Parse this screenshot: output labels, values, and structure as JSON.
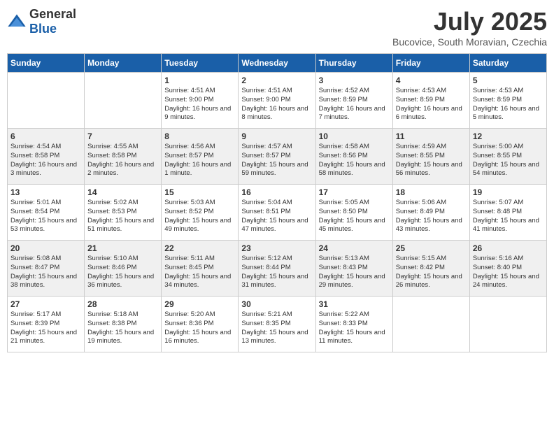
{
  "logo": {
    "general": "General",
    "blue": "Blue"
  },
  "title": "July 2025",
  "subtitle": "Bucovice, South Moravian, Czechia",
  "headers": [
    "Sunday",
    "Monday",
    "Tuesday",
    "Wednesday",
    "Thursday",
    "Friday",
    "Saturday"
  ],
  "weeks": [
    [
      {
        "day": "",
        "info": ""
      },
      {
        "day": "",
        "info": ""
      },
      {
        "day": "1",
        "info": "Sunrise: 4:51 AM\nSunset: 9:00 PM\nDaylight: 16 hours and 9 minutes."
      },
      {
        "day": "2",
        "info": "Sunrise: 4:51 AM\nSunset: 9:00 PM\nDaylight: 16 hours and 8 minutes."
      },
      {
        "day": "3",
        "info": "Sunrise: 4:52 AM\nSunset: 8:59 PM\nDaylight: 16 hours and 7 minutes."
      },
      {
        "day": "4",
        "info": "Sunrise: 4:53 AM\nSunset: 8:59 PM\nDaylight: 16 hours and 6 minutes."
      },
      {
        "day": "5",
        "info": "Sunrise: 4:53 AM\nSunset: 8:59 PM\nDaylight: 16 hours and 5 minutes."
      }
    ],
    [
      {
        "day": "6",
        "info": "Sunrise: 4:54 AM\nSunset: 8:58 PM\nDaylight: 16 hours and 3 minutes."
      },
      {
        "day": "7",
        "info": "Sunrise: 4:55 AM\nSunset: 8:58 PM\nDaylight: 16 hours and 2 minutes."
      },
      {
        "day": "8",
        "info": "Sunrise: 4:56 AM\nSunset: 8:57 PM\nDaylight: 16 hours and 1 minute."
      },
      {
        "day": "9",
        "info": "Sunrise: 4:57 AM\nSunset: 8:57 PM\nDaylight: 15 hours and 59 minutes."
      },
      {
        "day": "10",
        "info": "Sunrise: 4:58 AM\nSunset: 8:56 PM\nDaylight: 15 hours and 58 minutes."
      },
      {
        "day": "11",
        "info": "Sunrise: 4:59 AM\nSunset: 8:55 PM\nDaylight: 15 hours and 56 minutes."
      },
      {
        "day": "12",
        "info": "Sunrise: 5:00 AM\nSunset: 8:55 PM\nDaylight: 15 hours and 54 minutes."
      }
    ],
    [
      {
        "day": "13",
        "info": "Sunrise: 5:01 AM\nSunset: 8:54 PM\nDaylight: 15 hours and 53 minutes."
      },
      {
        "day": "14",
        "info": "Sunrise: 5:02 AM\nSunset: 8:53 PM\nDaylight: 15 hours and 51 minutes."
      },
      {
        "day": "15",
        "info": "Sunrise: 5:03 AM\nSunset: 8:52 PM\nDaylight: 15 hours and 49 minutes."
      },
      {
        "day": "16",
        "info": "Sunrise: 5:04 AM\nSunset: 8:51 PM\nDaylight: 15 hours and 47 minutes."
      },
      {
        "day": "17",
        "info": "Sunrise: 5:05 AM\nSunset: 8:50 PM\nDaylight: 15 hours and 45 minutes."
      },
      {
        "day": "18",
        "info": "Sunrise: 5:06 AM\nSunset: 8:49 PM\nDaylight: 15 hours and 43 minutes."
      },
      {
        "day": "19",
        "info": "Sunrise: 5:07 AM\nSunset: 8:48 PM\nDaylight: 15 hours and 41 minutes."
      }
    ],
    [
      {
        "day": "20",
        "info": "Sunrise: 5:08 AM\nSunset: 8:47 PM\nDaylight: 15 hours and 38 minutes."
      },
      {
        "day": "21",
        "info": "Sunrise: 5:10 AM\nSunset: 8:46 PM\nDaylight: 15 hours and 36 minutes."
      },
      {
        "day": "22",
        "info": "Sunrise: 5:11 AM\nSunset: 8:45 PM\nDaylight: 15 hours and 34 minutes."
      },
      {
        "day": "23",
        "info": "Sunrise: 5:12 AM\nSunset: 8:44 PM\nDaylight: 15 hours and 31 minutes."
      },
      {
        "day": "24",
        "info": "Sunrise: 5:13 AM\nSunset: 8:43 PM\nDaylight: 15 hours and 29 minutes."
      },
      {
        "day": "25",
        "info": "Sunrise: 5:15 AM\nSunset: 8:42 PM\nDaylight: 15 hours and 26 minutes."
      },
      {
        "day": "26",
        "info": "Sunrise: 5:16 AM\nSunset: 8:40 PM\nDaylight: 15 hours and 24 minutes."
      }
    ],
    [
      {
        "day": "27",
        "info": "Sunrise: 5:17 AM\nSunset: 8:39 PM\nDaylight: 15 hours and 21 minutes."
      },
      {
        "day": "28",
        "info": "Sunrise: 5:18 AM\nSunset: 8:38 PM\nDaylight: 15 hours and 19 minutes."
      },
      {
        "day": "29",
        "info": "Sunrise: 5:20 AM\nSunset: 8:36 PM\nDaylight: 15 hours and 16 minutes."
      },
      {
        "day": "30",
        "info": "Sunrise: 5:21 AM\nSunset: 8:35 PM\nDaylight: 15 hours and 13 minutes."
      },
      {
        "day": "31",
        "info": "Sunrise: 5:22 AM\nSunset: 8:33 PM\nDaylight: 15 hours and 11 minutes."
      },
      {
        "day": "",
        "info": ""
      },
      {
        "day": "",
        "info": ""
      }
    ]
  ]
}
